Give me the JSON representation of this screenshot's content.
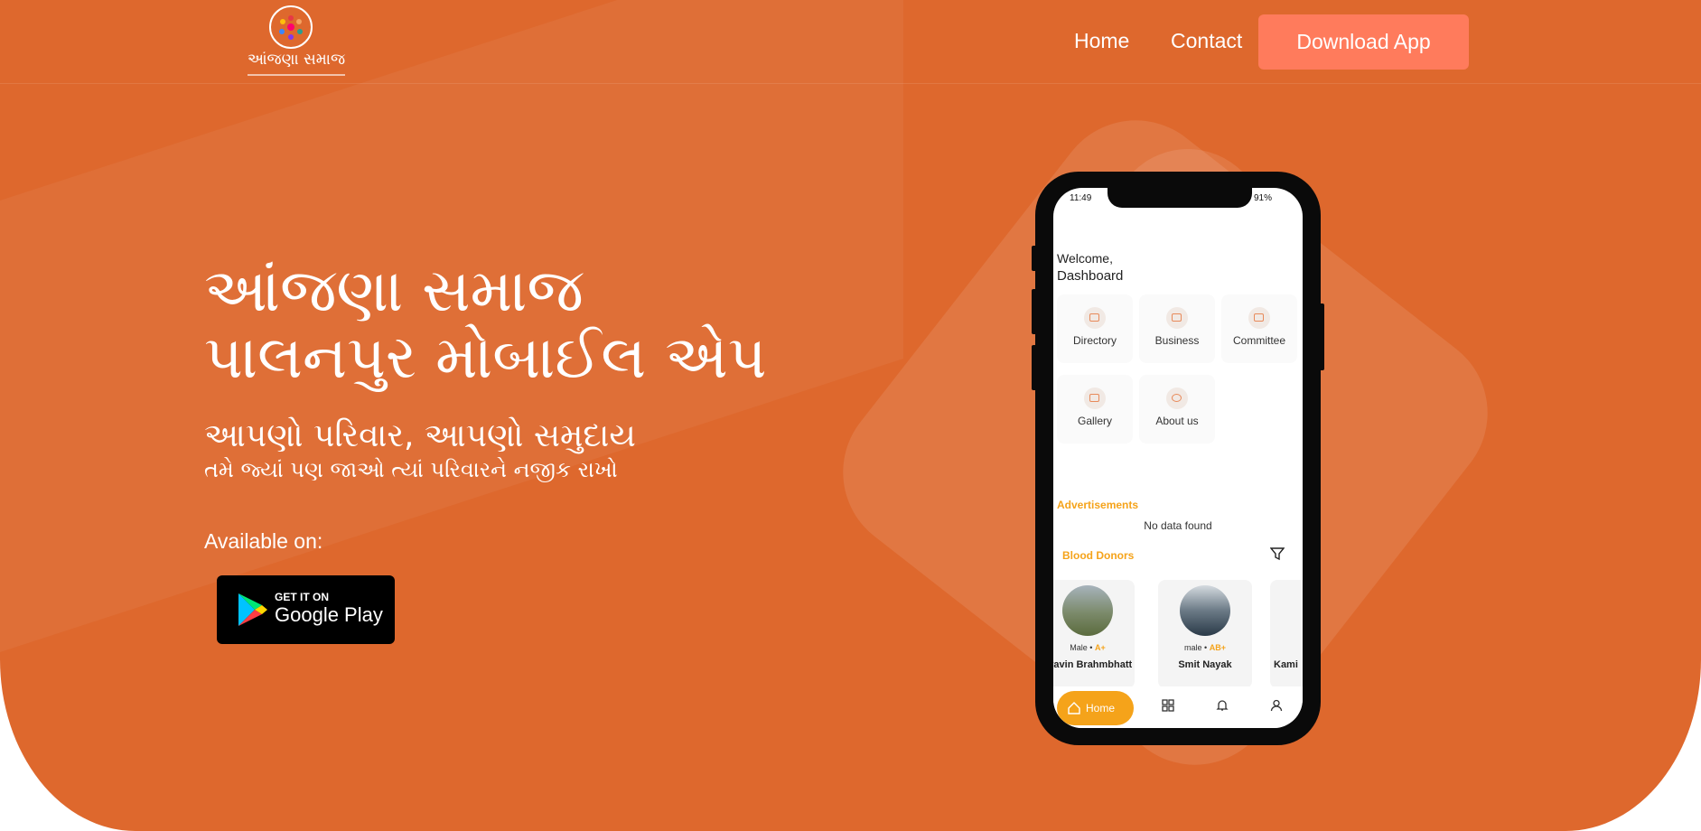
{
  "brand": {
    "logo_text": "આંજણા સમાજ",
    "accent": "#de682d",
    "button_color": "#ff7b5c",
    "app_accent": "#f5a31a"
  },
  "nav": {
    "home": "Home",
    "contact": "Contact",
    "download": "Download App"
  },
  "hero": {
    "title_line1": "આંજણા સમાજ",
    "title_line2": "પાલનપુર મોબાઈલ એપ",
    "tagline": "આપણો પરિવાર, આપણો સમુદાય",
    "subtagline": "તમે જ્યાં પણ જાઓ ત્યાં પરિવારને નજીક રાખો",
    "available": "Available on:",
    "store_small": "GET IT ON",
    "store_big": "Google Play"
  },
  "phone": {
    "time": "11:49",
    "battery": "91%",
    "welcome": "Welcome,",
    "dashboard": "Dashboard",
    "tiles": [
      {
        "label": "Directory",
        "icon": "id-card-icon"
      },
      {
        "label": "Business",
        "icon": "briefcase-icon"
      },
      {
        "label": "Committee",
        "icon": "briefcase-icon"
      },
      {
        "label": "Gallery",
        "icon": "image-icon"
      },
      {
        "label": "About us",
        "icon": "info-icon"
      }
    ],
    "ads_title": "Advertisements",
    "no_data": "No data found",
    "donors_title": "Blood Donors",
    "donors": [
      {
        "gender": "Male",
        "blood": "A+",
        "name": "Pravin Brahmbhatt"
      },
      {
        "gender": "male",
        "blood": "AB+",
        "name": "Smit Nayak"
      },
      {
        "gender": "",
        "blood": "",
        "name": "Kami"
      }
    ],
    "tabbar": {
      "home": "Home"
    }
  }
}
